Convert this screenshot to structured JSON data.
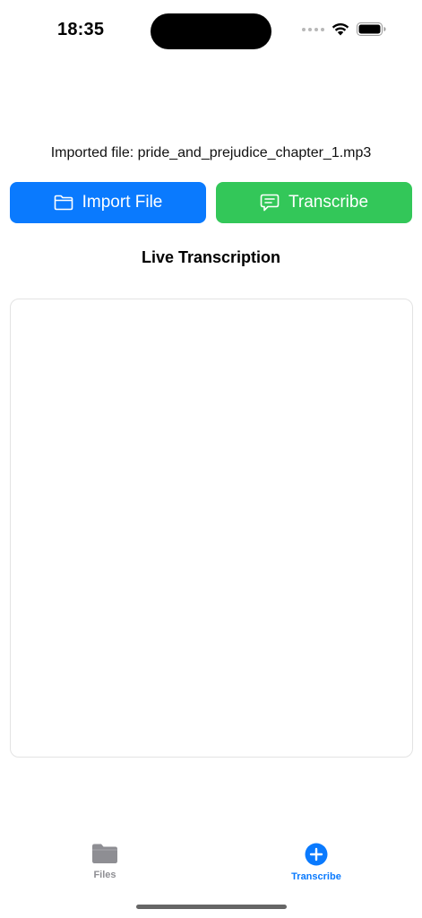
{
  "status_bar": {
    "time": "18:35"
  },
  "imported_file": {
    "text": "Imported file: pride_and_prejudice_chapter_1.mp3"
  },
  "actions": {
    "import_label": "Import File",
    "transcribe_label": "Transcribe"
  },
  "transcription": {
    "title": "Live Transcription",
    "content": ""
  },
  "tab_bar": {
    "items": [
      {
        "label": "Files",
        "icon": "folder-icon",
        "active": false
      },
      {
        "label": "Transcribe",
        "icon": "plus-circle-icon",
        "active": true
      }
    ]
  },
  "colors": {
    "import_button": "#0a7afe",
    "transcribe_button": "#33c759",
    "active_tab": "#0a7afe",
    "inactive_tab": "#8e8e93"
  }
}
